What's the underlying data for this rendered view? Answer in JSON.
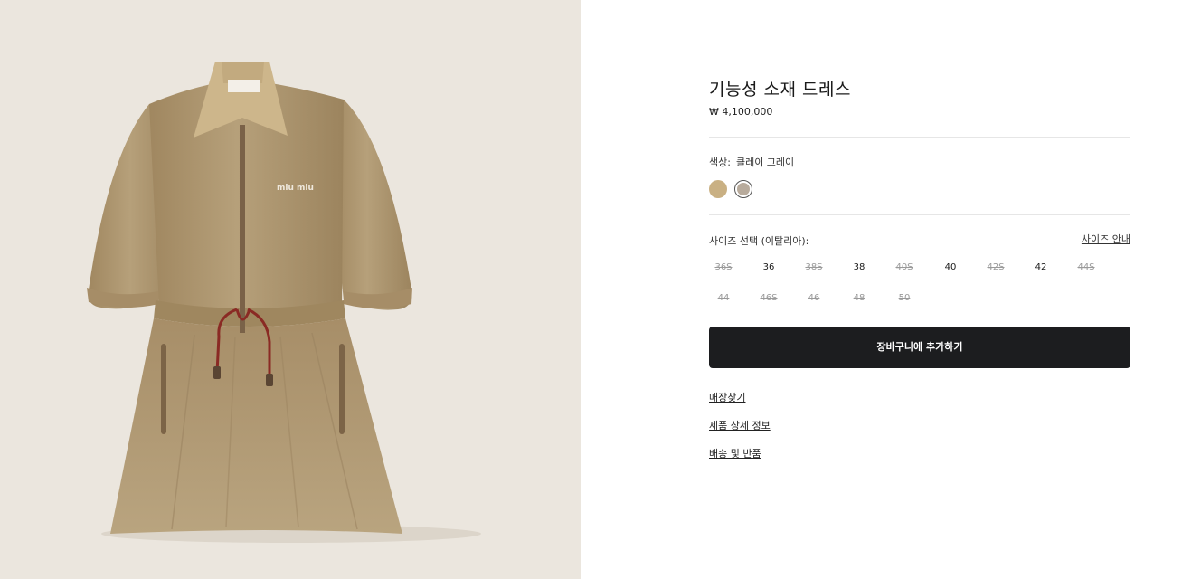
{
  "product": {
    "title": "기능성 소재 드레스",
    "price": "₩ 4,100,000",
    "image_alt": "Beige short-sleeve zip dress with drawstring waist"
  },
  "color": {
    "label": "색상:",
    "selected": "클레이 그레이",
    "swatches": [
      {
        "name": "beige",
        "hex": "#c9b083"
      },
      {
        "name": "clay-grey",
        "hex": "#b8ab9c"
      }
    ]
  },
  "size": {
    "label": "사이즈 선택 (이탈리아):",
    "guide": "사이즈 안내",
    "options": [
      {
        "label": "36S",
        "available": false
      },
      {
        "label": "36",
        "available": true
      },
      {
        "label": "38S",
        "available": false
      },
      {
        "label": "38",
        "available": true
      },
      {
        "label": "40S",
        "available": false
      },
      {
        "label": "40",
        "available": true
      },
      {
        "label": "42S",
        "available": false
      },
      {
        "label": "42",
        "available": true
      },
      {
        "label": "44S",
        "available": false
      },
      {
        "label": "44",
        "available": false
      },
      {
        "label": "46S",
        "available": false
      },
      {
        "label": "46",
        "available": false
      },
      {
        "label": "48",
        "available": false
      },
      {
        "label": "50",
        "available": false
      }
    ]
  },
  "cart": {
    "label": "장바구니에 추가하기"
  },
  "links": {
    "store": "매장찾기",
    "details": "제품 상세 정보",
    "shipping": "배송 및 반품"
  },
  "colors": {
    "image_bg": "#ebe6de",
    "dress": "#b29a72",
    "collar": "#cbb487",
    "button": "#1c1d1f"
  }
}
